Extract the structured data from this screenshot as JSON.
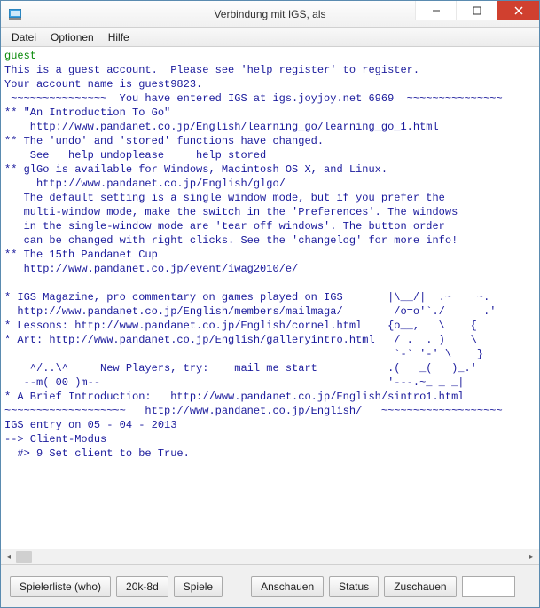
{
  "window": {
    "title": "Verbindung mit IGS, als"
  },
  "menu": {
    "file": "Datei",
    "options": "Optionen",
    "help": "Hilfe"
  },
  "terminal": {
    "guest": "guest",
    "l1": "This is a guest account.  Please see 'help register' to register.",
    "l2": "Your account name is guest9823.",
    "l3": " ~~~~~~~~~~~~~~~  You have entered IGS at igs.joyjoy.net 6969  ~~~~~~~~~~~~~~~",
    "l4": "** \"An Introduction To Go\"",
    "l5": "    http://www.pandanet.co.jp/English/learning_go/learning_go_1.html",
    "l6": "** The 'undo' and 'stored' functions have changed.",
    "l7": "    See   help undoplease     help stored",
    "l8": "** glGo is available for Windows, Macintosh OS X, and Linux.",
    "l9": "     http://www.pandanet.co.jp/English/glgo/",
    "l10": "   The default setting is a single window mode, but if you prefer the",
    "l11": "   multi-window mode, make the switch in the 'Preferences'. The windows",
    "l12": "   in the single-window mode are 'tear off windows'. The button order",
    "l13": "   can be changed with right clicks. See the 'changelog' for more info!",
    "l14": "** The 15th Pandanet Cup",
    "l15": "   http://www.pandanet.co.jp/event/iwag2010/e/",
    "l16": "",
    "l17": "* IGS Magazine, pro commentary on games played on IGS       |\\__/|  .~    ~.",
    "l18": "  http://www.pandanet.co.jp/English/members/mailmaga/        /o=o'`./      .'",
    "l19": "* Lessons: http://www.pandanet.co.jp/English/cornel.html    {o__,   \\    {",
    "l20": "* Art: http://www.pandanet.co.jp/English/galleryintro.html   / .  . )    \\",
    "l21": "                                                             `-` '-' \\    }",
    "l22": "    ^/..\\^     New Players, try:    mail me start           .(   _(   )_.'",
    "l23": "   --m( 00 )m--                                             '---.~_ _ _|",
    "l24": "* A Brief Introduction:   http://www.pandanet.co.jp/English/sintro1.html",
    "l25": "~~~~~~~~~~~~~~~~~~~   http://www.pandanet.co.jp/English/   ~~~~~~~~~~~~~~~~~~~",
    "l26": "IGS entry on 05 - 04 - 2013",
    "l27": "--> Client-Modus",
    "l28": "  #> 9 Set client to be True."
  },
  "buttons": {
    "playerlist": "Spielerliste (who)",
    "range": "20k-8d",
    "games": "Spiele",
    "watch": "Anschauen",
    "status": "Status",
    "observe": "Zuschauen"
  }
}
